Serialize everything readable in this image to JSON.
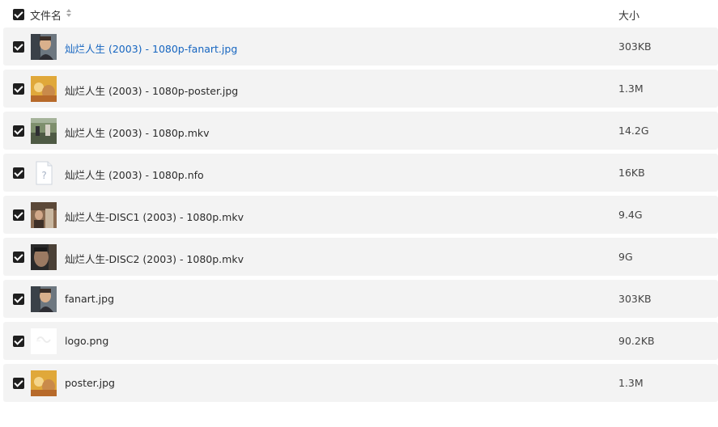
{
  "header": {
    "name_label": "文件名",
    "size_label": "大小"
  },
  "files": [
    {
      "name": "灿烂人生 (2003) - 1080p-fanart.jpg",
      "size": "303KB",
      "thumb": "photo-man",
      "highlight": true
    },
    {
      "name": "灿烂人生 (2003) - 1080p-poster.jpg",
      "size": "1.3M",
      "thumb": "poster"
    },
    {
      "name": "灿烂人生 (2003) - 1080p.mkv",
      "size": "14.2G",
      "thumb": "video-street"
    },
    {
      "name": "灿烂人生 (2003) - 1080p.nfo",
      "size": "16KB",
      "thumb": "unknown-file"
    },
    {
      "name": "灿烂人生-DISC1 (2003) - 1080p.mkv",
      "size": "9.4G",
      "thumb": "video-room"
    },
    {
      "name": "灿烂人生-DISC2 (2003) - 1080p.mkv",
      "size": "9G",
      "thumb": "video-face"
    },
    {
      "name": "fanart.jpg",
      "size": "303KB",
      "thumb": "photo-man"
    },
    {
      "name": "logo.png",
      "size": "90.2KB",
      "thumb": "logo"
    },
    {
      "name": "poster.jpg",
      "size": "1.3M",
      "thumb": "poster"
    }
  ],
  "colors": {
    "row_bg": "#f3f3f3",
    "checkbox": "#1f1f1f",
    "link": "#1565c0"
  }
}
